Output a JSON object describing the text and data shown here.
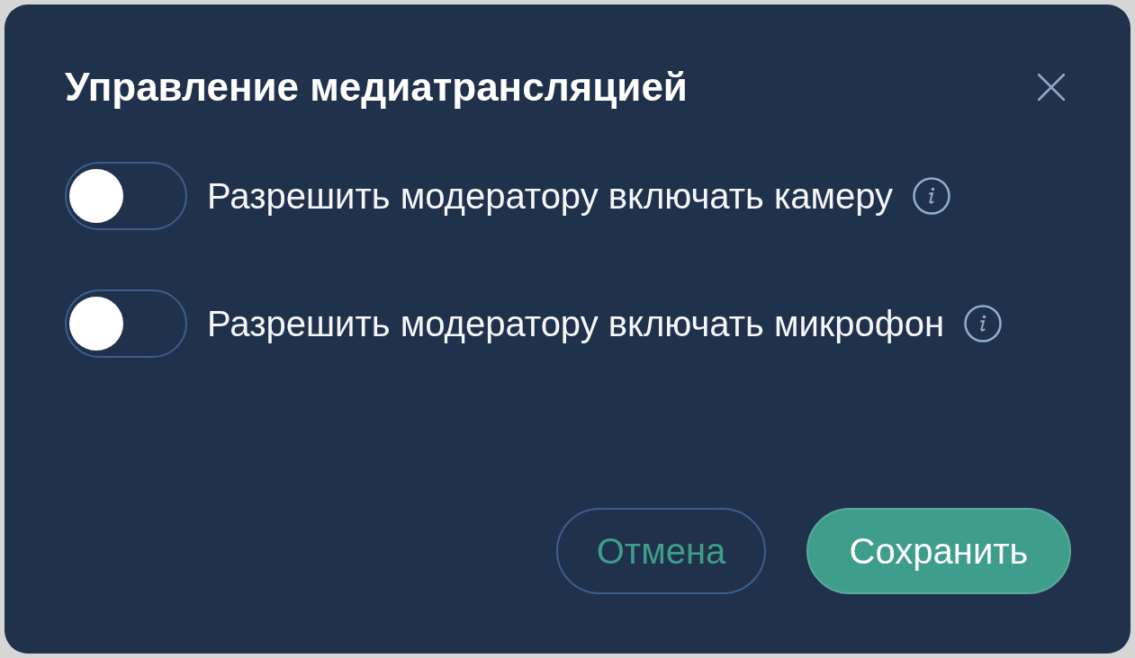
{
  "dialog": {
    "title": "Управление медиатрансляцией",
    "options": [
      {
        "label": "Разрешить модератору включать камеру",
        "checked": false
      },
      {
        "label": "Разрешить модератору включать микрофон",
        "checked": false
      }
    ],
    "buttons": [
      {
        "label": "Отмена",
        "kind": "secondary"
      },
      {
        "label": "Сохранить",
        "kind": "primary"
      }
    ]
  }
}
